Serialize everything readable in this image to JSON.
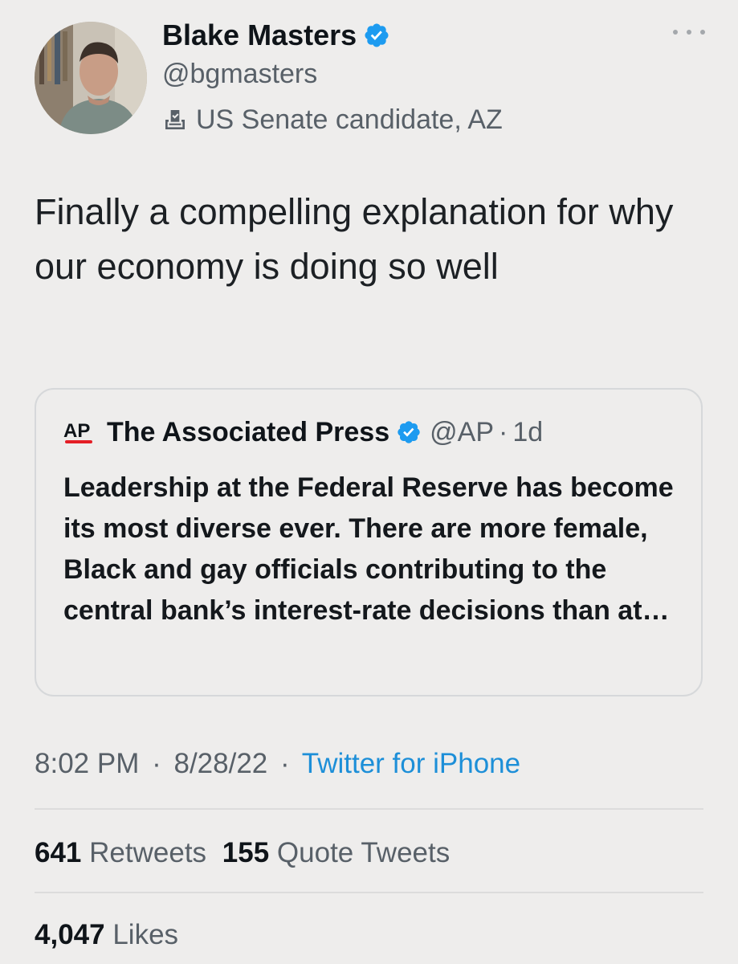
{
  "author": {
    "display_name": "Blake Masters",
    "handle": "@bgmasters",
    "bio_label": "US Senate candidate, AZ",
    "verified": true
  },
  "icons": {
    "verified": "verified-badge-icon",
    "ballot": "ballot-box-icon",
    "more": "more-options-icon",
    "ap_logo": "ap-logo"
  },
  "colors": {
    "background": "#eeedec",
    "verified_blue": "#1d9bf0",
    "link_blue": "#1d8fd8",
    "secondary_text": "#586068",
    "primary_text": "#0f1419",
    "ap_red": "#e41e26"
  },
  "tweet": {
    "text": "Finally a compelling explanation for why our economy is doing so well"
  },
  "quoted_tweet": {
    "logo_text": "AP",
    "name": "The Associated Press",
    "handle": "@AP",
    "separator": "·",
    "age": "1d",
    "text": "Leadership at the Federal Reserve has become its most diverse ever. There are more female, Black and gay officials contributing to the central bank’s interest-rate decisions than at…"
  },
  "meta": {
    "time": "8:02 PM",
    "separator": "·",
    "date": "8/28/22",
    "source": "Twitter for iPhone"
  },
  "stats": {
    "retweets_count": "641",
    "retweets_label": "Retweets",
    "quotes_count": "155",
    "quotes_label": "Quote Tweets",
    "likes_count": "4,047",
    "likes_label": "Likes"
  }
}
